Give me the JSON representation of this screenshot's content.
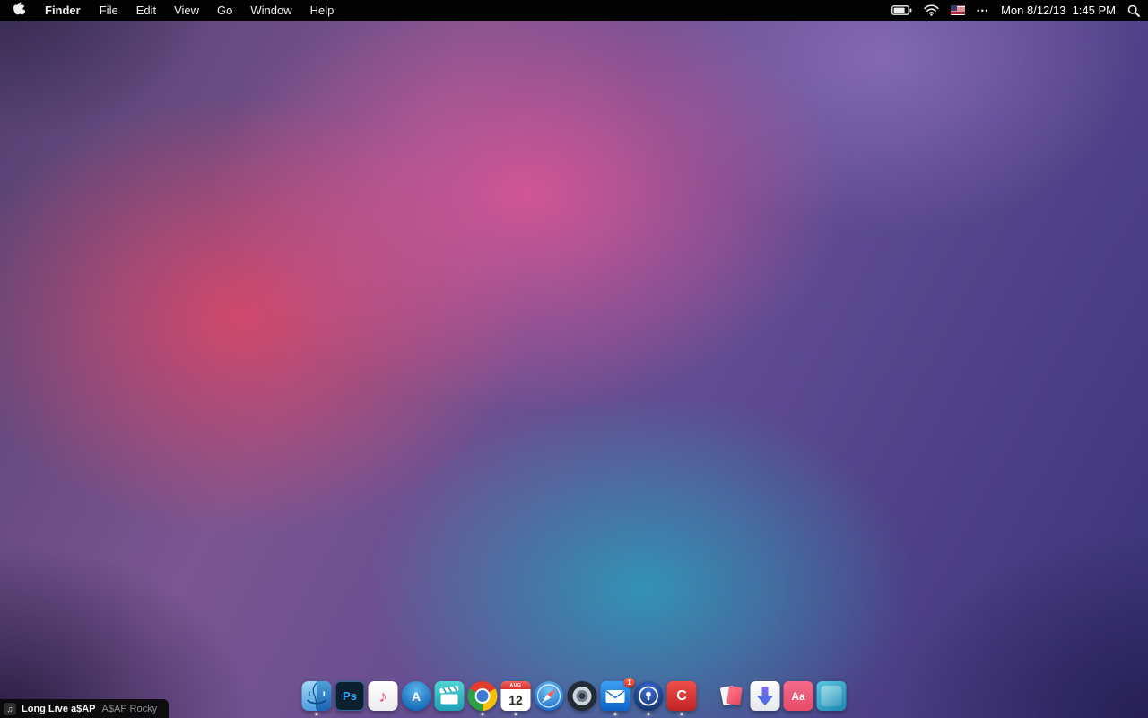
{
  "menu_bar": {
    "items": [
      "Finder",
      "File",
      "Edit",
      "View",
      "Go",
      "Window",
      "Help"
    ],
    "status": {
      "more_dots": "•••",
      "clock": "Mon 8/12/13  1:45 PM"
    }
  },
  "dock": {
    "apps": [
      {
        "name": "Finder",
        "running": true
      },
      {
        "name": "Photoshop",
        "text": "Ps",
        "running": false
      },
      {
        "name": "iTunes",
        "note": "♪",
        "running": false
      },
      {
        "name": "App Store",
        "text": "A",
        "running": false
      },
      {
        "name": "Video app",
        "running": false
      },
      {
        "name": "Chrome",
        "running": true
      },
      {
        "name": "Calendar",
        "month": "AUG",
        "day": "12",
        "running": true
      },
      {
        "name": "Safari",
        "running": false
      },
      {
        "name": "Lens app",
        "running": false
      },
      {
        "name": "Mail",
        "badge": "1",
        "running": true
      },
      {
        "name": "Keyhole app",
        "running": true
      },
      {
        "name": "C app",
        "text": "C",
        "running": true
      },
      {
        "name": "Documents stack",
        "running": false
      },
      {
        "name": "Downloads",
        "running": false
      },
      {
        "name": "Fonts app",
        "text": "Aa",
        "running": false
      },
      {
        "name": "Teal app",
        "running": false
      }
    ]
  },
  "now_playing": {
    "icon": "♫",
    "title": "Long Live a$AP",
    "artist": "A$AP Rocky"
  },
  "colors": {
    "menu_bar": "#020202",
    "wallpaper_pink": "#e2568b",
    "wallpaper_teal": "#3096b6",
    "badge_red": "#df2f1e"
  }
}
